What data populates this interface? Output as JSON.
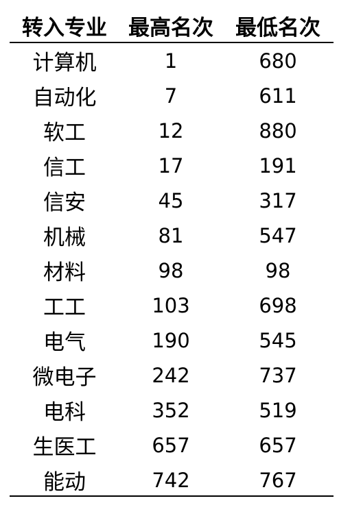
{
  "table": {
    "headers": [
      "转入专业",
      "最高名次",
      "最低名次"
    ],
    "rows": [
      [
        "计算机",
        "1",
        "680"
      ],
      [
        "自动化",
        "7",
        "611"
      ],
      [
        "软工",
        "12",
        "880"
      ],
      [
        "信工",
        "17",
        "191"
      ],
      [
        "信安",
        "45",
        "317"
      ],
      [
        "机械",
        "81",
        "547"
      ],
      [
        "材料",
        "98",
        "98"
      ],
      [
        "工工",
        "103",
        "698"
      ],
      [
        "电气",
        "190",
        "545"
      ],
      [
        "微电子",
        "242",
        "737"
      ],
      [
        "电科",
        "352",
        "519"
      ],
      [
        "生医工",
        "657",
        "657"
      ],
      [
        "能动",
        "742",
        "767"
      ]
    ]
  }
}
